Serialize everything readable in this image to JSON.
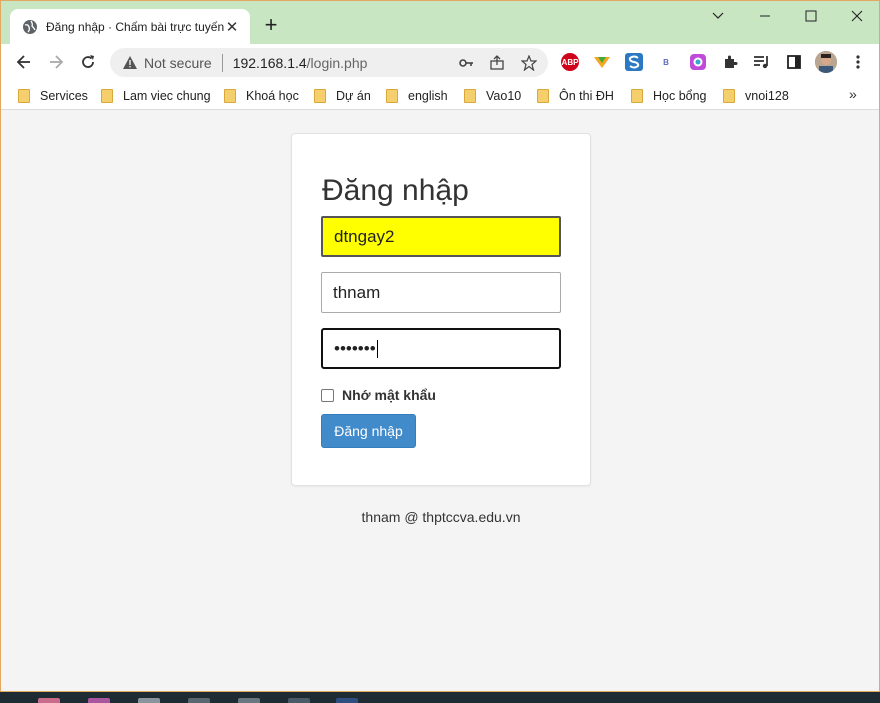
{
  "browser": {
    "tab": {
      "title": "Đăng nhập · Chấm bài trực tuyến",
      "close": "✕"
    },
    "new_tab": "+",
    "window_controls": {
      "minimize": "—",
      "maximize": "☐",
      "close": "✕"
    },
    "address": {
      "security_label": "Not secure",
      "host": "192.168.1.4",
      "path": "/login.php"
    },
    "extensions": [
      "ABP"
    ],
    "bookmarks": [
      "Services",
      "Lam viec chung",
      "Khoá học",
      "Dự án",
      "english",
      "Vao10",
      "Ôn thi ĐH",
      "Học bổng",
      "vnoi128"
    ],
    "bookmarks_more": "»"
  },
  "login": {
    "heading": "Đăng nhập",
    "field1_value": "dtngay2",
    "field2_value": "thnam",
    "password_mask": "•••••••",
    "remember_label": "Nhớ mật khẩu",
    "submit_label": "Đăng nhập"
  },
  "footer": {
    "text": "thnam @ thptccva.edu.vn"
  },
  "colors": {
    "tabstrip": "#c8e6c2",
    "autofill": "#ffff00",
    "primary": "#428bca",
    "page_bg": "#f4f4f4"
  }
}
